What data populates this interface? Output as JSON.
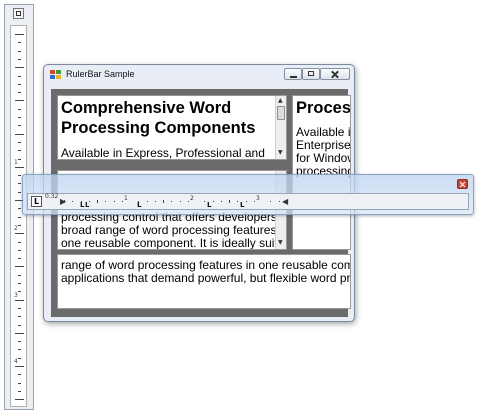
{
  "window": {
    "title": "RulerBar Sample"
  },
  "editors": {
    "left_top": {
      "heading_line1": "Comprehensive Word",
      "heading_line2": "Processing Components",
      "body_line1": "Available in Express, Professional and"
    },
    "right_top": {
      "heading": "Proces",
      "lines": [
        "Available in",
        "Enterprise",
        "for Window",
        "processing"
      ]
    },
    "left_middle": {
      "lines": [
        "processing control that offers developers a",
        "broad range of word processing features in",
        "one reusable component. It is ideally suited"
      ]
    },
    "bottom": {
      "lines": [
        "range of word processing features in one reusable compon",
        "applications that demand powerful, but flexible word proces"
      ]
    }
  },
  "horizontal_ruler": {
    "tab_selector": "L",
    "position_label": "0.32",
    "numbers": [
      "1",
      "2",
      "3"
    ]
  },
  "vertical_ruler": {
    "numbers": [
      "1",
      "2",
      "3",
      "4"
    ]
  },
  "colors": {
    "client_background": "#6b6b6b",
    "ruler_overlay": "#bed4f0",
    "close_button": "#c7463a"
  },
  "icons": {
    "app": "rulerbar-app-icon",
    "close": "close-icon",
    "minimize": "minimize-icon",
    "maximize": "maximize-icon"
  }
}
